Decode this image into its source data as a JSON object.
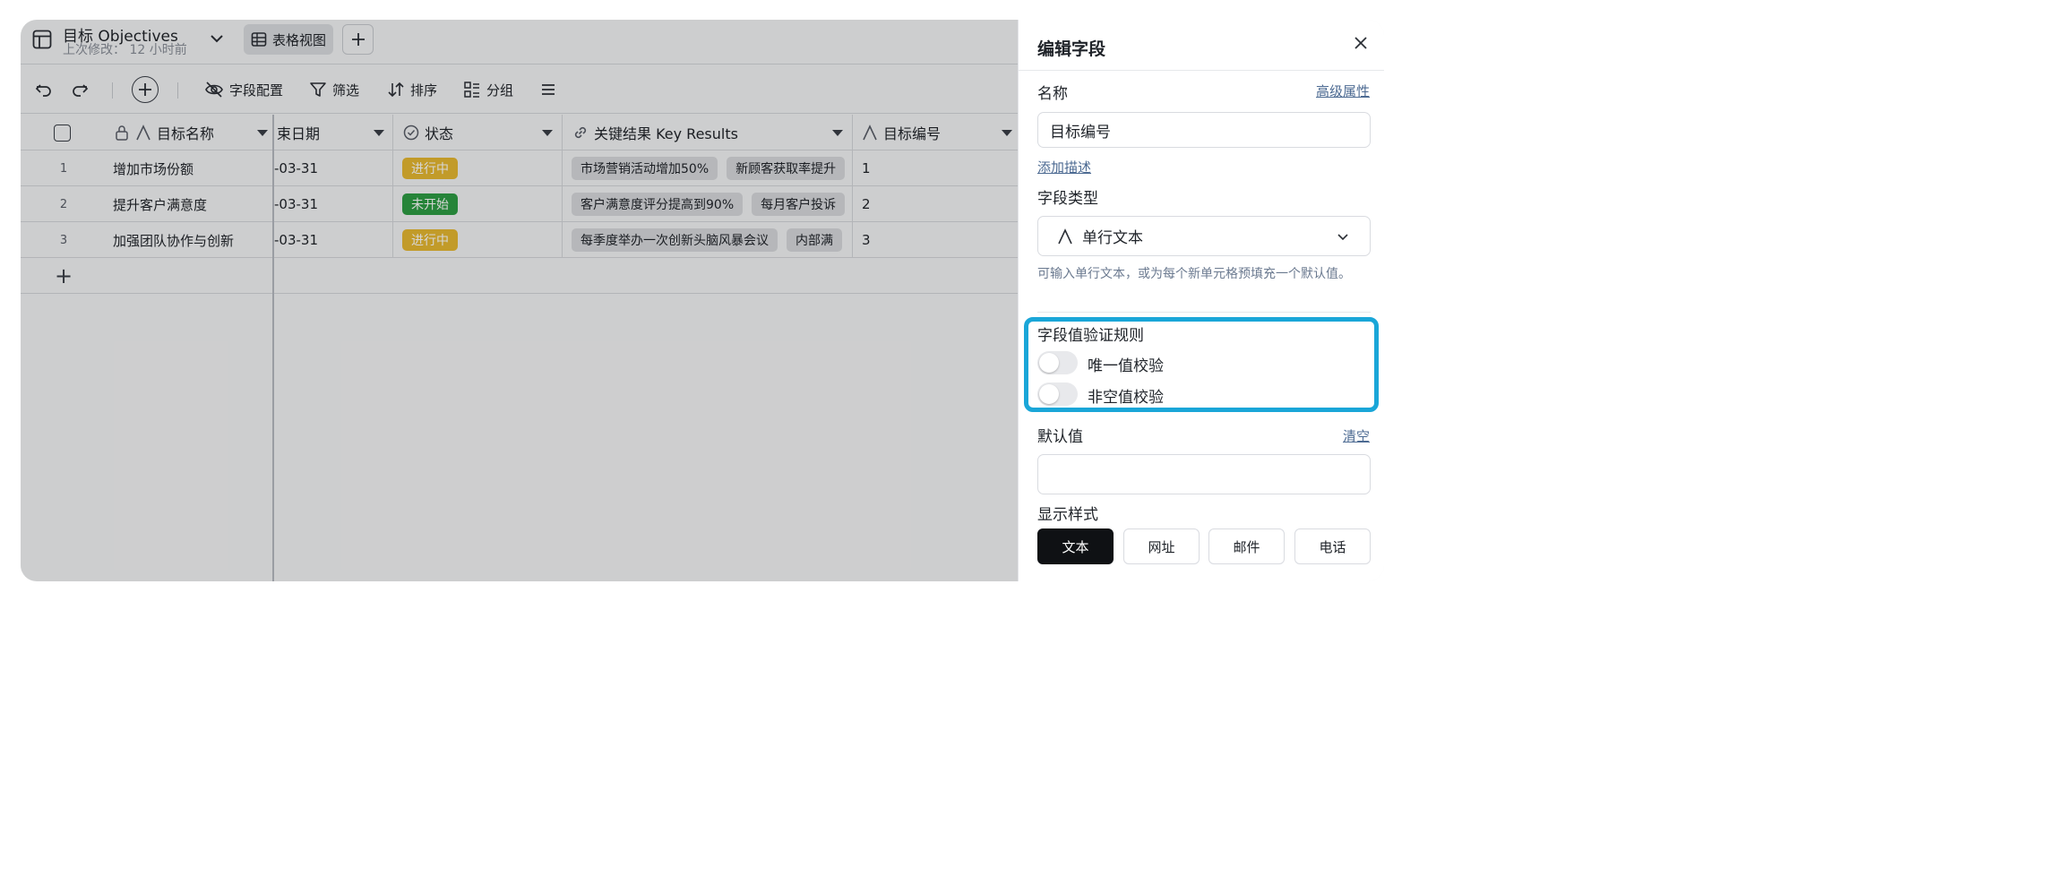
{
  "header": {
    "table_title": "目标 Objectives",
    "last_modified": "上次修改： 12 小时前",
    "view_tab_label": "表格视图",
    "icons": [
      "table-icon",
      "chevron-down-icon",
      "grid-icon",
      "plus-icon"
    ]
  },
  "toolbar": {
    "field_config": "字段配置",
    "filter": "筛选",
    "sort": "排序",
    "group": "分组",
    "icons": [
      "undo-icon",
      "redo-icon",
      "add-record-icon",
      "eye-off-icon",
      "filter-icon",
      "sort-icon",
      "group-icon",
      "menu-icon"
    ]
  },
  "grid": {
    "columns": [
      {
        "key": "name",
        "label": "目标名称"
      },
      {
        "key": "end_date",
        "label": "束日期"
      },
      {
        "key": "status",
        "label": "状态"
      },
      {
        "key": "key_results",
        "label": "关键结果 Key Results"
      },
      {
        "key": "number",
        "label": "目标编号"
      }
    ],
    "rows": [
      {
        "index": "1",
        "name": "增加市场份额",
        "end_date": "-03-31",
        "status": "进行中",
        "status_color": "#e8b931",
        "key_results": [
          "市场营销活动增加50%",
          "新顾客获取率提升"
        ],
        "number": "1"
      },
      {
        "index": "2",
        "name": "提升客户满意度",
        "end_date": "-03-31",
        "status": "未开始",
        "status_color": "#2e9e44",
        "key_results": [
          "客户满意度评分提高到90%",
          "每月客户投诉"
        ],
        "number": "2"
      },
      {
        "index": "3",
        "name": "加强团队协作与创新",
        "end_date": "-03-31",
        "status": "进行中",
        "status_color": "#e8b931",
        "key_results": [
          "每季度举办一次创新头脑风暴会议",
          "内部满"
        ],
        "number": "3"
      }
    ],
    "add_row_label": "+"
  },
  "panel": {
    "title": "编辑字段",
    "name_label": "名称",
    "advanced_link": "高级属性",
    "name_value": "目标编号",
    "add_description_link": "添加描述",
    "field_type_label": "字段类型",
    "field_type_value": "单行文本",
    "field_type_hint": "可输入单行文本，或为每个新单元格预填充一个默认值。",
    "validation_title": "字段值验证规则",
    "unique_check_label": "唯一值校验",
    "unique_check_enabled": false,
    "not_empty_check_label": "非空值校验",
    "not_empty_check_enabled": false,
    "default_value_label": "默认值",
    "clear_link": "清空",
    "default_value": "",
    "display_style_label": "显示样式",
    "display_styles": [
      "文本",
      "网址",
      "邮件",
      "电话"
    ],
    "selected_display_style": "文本",
    "highlight_color": "#1aa6d8"
  }
}
